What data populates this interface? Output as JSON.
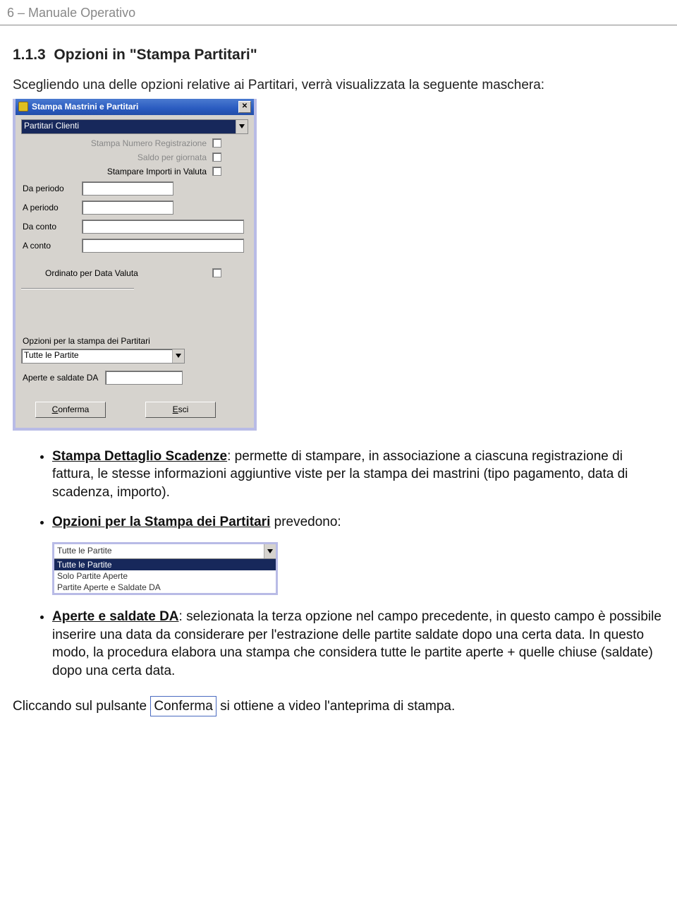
{
  "header": {
    "page_number": "6",
    "sep": " – ",
    "title": "Manuale Operativo"
  },
  "section": {
    "number": "1.1.3",
    "title": "Opzioni in \"Stampa Partitari\""
  },
  "intro": "Scegliendo una delle opzioni relative ai Partitari, verrà visualizzata la seguente maschera:",
  "dialog": {
    "title": "Stampa Mastrini e Partitari",
    "combo1_value": "Partitari Clienti",
    "opt1": "Stampa Numero Registrazione",
    "opt2": "Saldo per giornata",
    "opt3": "Stampare Importi in Valuta",
    "da_periodo": "Da periodo",
    "a_periodo": "A periodo",
    "da_conto": "Da conto",
    "a_conto": "A conto",
    "ordinato": "Ordinato per Data Valuta",
    "opzioni_label": "Opzioni per la stampa dei Partitari",
    "combo2_value": "Tutte le Partite",
    "aperte_label": "Aperte e saldate DA",
    "conferma": "Conferma",
    "conferma_u": "C",
    "esci": "Esci",
    "esci_u": "E"
  },
  "bullets": {
    "b1_bold": "Stampa Dettaglio Scadenze",
    "b1_rest": ": permette di stampare, in associazione a ciascuna registrazione di fattura, le stesse informazioni aggiuntive viste per la stampa dei mastrini (tipo pagamento, data di scadenza, importo).",
    "b2_bold": "Opzioni per la Stampa dei Partitari",
    "b2_rest": " prevedono:",
    "b3_bold": "Aperte e saldate DA",
    "b3_rest": ": selezionata la terza opzione nel campo precedente, in questo campo è possibile inserire una data da considerare per l'estrazione delle partite saldate dopo una certa data. In questo modo, la procedura elabora una stampa che considera tutte le partite aperte + quelle chiuse (saldate) dopo una certa data."
  },
  "dropdown": {
    "top": "Tutte le Partite",
    "items": [
      "Tutte le Partite",
      "Solo Partite Aperte",
      "Partite Aperte e Saldate DA"
    ]
  },
  "closing": {
    "pre": "Cliccando sul pulsante ",
    "btn": "Conferma",
    "post": " si ottiene a video l'anteprima di stampa."
  }
}
